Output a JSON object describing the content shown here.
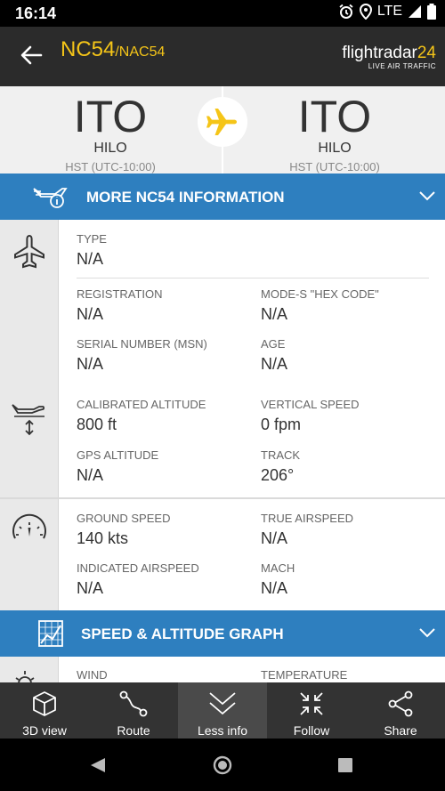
{
  "status": {
    "time": "16:14",
    "network": "LTE"
  },
  "header": {
    "callsign": "NC54",
    "alt_callsign": "/NAC54",
    "brand_a": "flightradar",
    "brand_b": "24",
    "tagline": "LIVE AIR TRAFFIC"
  },
  "route": {
    "origin": {
      "code": "ITO",
      "city": "HILO",
      "tz": "HST (UTC-10:00)"
    },
    "destination": {
      "code": "ITO",
      "city": "HILO",
      "tz": "HST (UTC-10:00)"
    }
  },
  "more_info": {
    "label": "MORE NC54 INFORMATION"
  },
  "aircraft": {
    "type_label": "TYPE",
    "type_value": "N/A",
    "registration_label": "REGISTRATION",
    "registration_value": "N/A",
    "modes_label": "MODE-S \"HEX CODE\"",
    "modes_value": "N/A",
    "msn_label": "SERIAL NUMBER (MSN)",
    "msn_value": "N/A",
    "age_label": "AGE",
    "age_value": "N/A"
  },
  "altitude": {
    "cal_label": "CALIBRATED ALTITUDE",
    "cal_value": "800 ft",
    "vs_label": "VERTICAL SPEED",
    "vs_value": "0 fpm",
    "gps_label": "GPS ALTITUDE",
    "gps_value": "N/A",
    "track_label": "TRACK",
    "track_value": "206°"
  },
  "speed": {
    "gs_label": "GROUND SPEED",
    "gs_value": "140 kts",
    "tas_label": "TRUE AIRSPEED",
    "tas_value": "N/A",
    "ias_label": "INDICATED AIRSPEED",
    "ias_value": "N/A",
    "mach_label": "MACH",
    "mach_value": "N/A"
  },
  "graph": {
    "label": "SPEED & ALTITUDE GRAPH"
  },
  "weather": {
    "wind_label": "WIND",
    "temp_label": "TEMPERATURE"
  },
  "nav": {
    "view3d": "3D view",
    "route": "Route",
    "less": "Less info",
    "follow": "Follow",
    "share": "Share"
  },
  "colors": {
    "accent": "#f5c518",
    "blue": "#2e7fbf",
    "dark": "#2b2b2b"
  }
}
